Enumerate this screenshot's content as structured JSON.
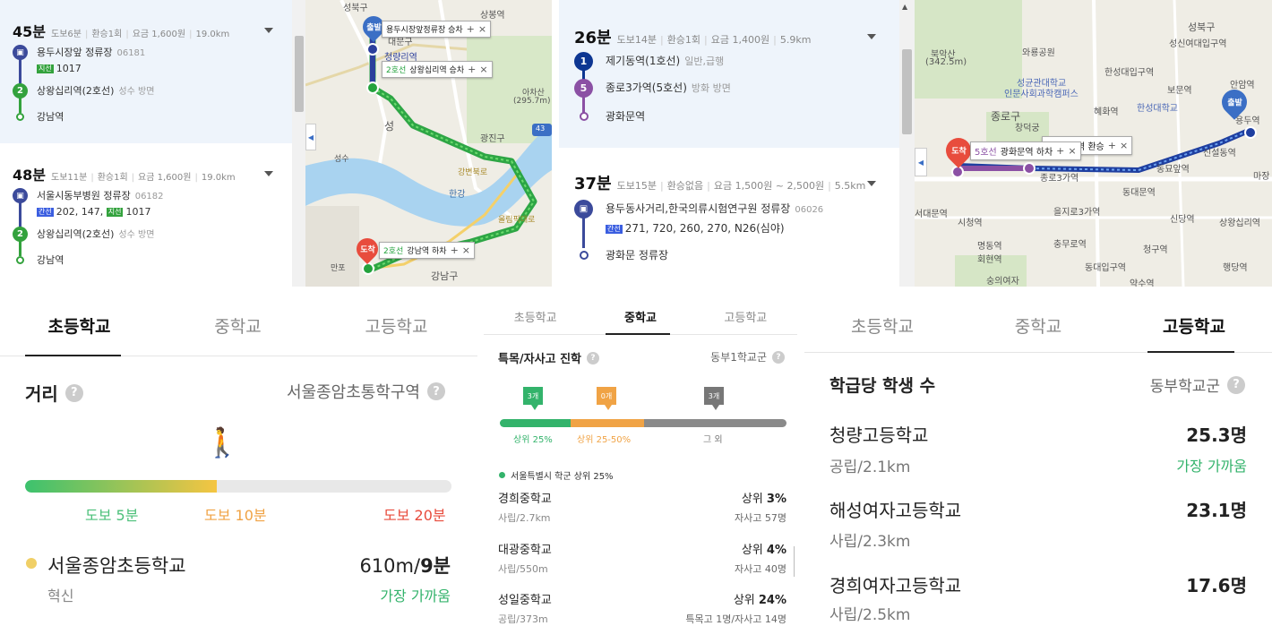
{
  "panel1": {
    "routes": [
      {
        "time": "45분",
        "meta": [
          "도보6분",
          "환승1회",
          "요금 1,600원",
          "19.0km"
        ],
        "steps": [
          {
            "name": "용두시장앞 정류장",
            "sub": "06181",
            "tag": "지선",
            "buses": "1017"
          },
          {
            "num": "2",
            "name": "상왕십리역(2호선)",
            "sub": "성수 방면"
          },
          {
            "name": "강남역"
          }
        ]
      },
      {
        "time": "48분",
        "meta": [
          "도보11분",
          "환승1회",
          "요금 1,600원",
          "19.0km"
        ],
        "steps": [
          {
            "name": "서울시동부병원 정류장",
            "sub": "06182",
            "tag": "간선",
            "buses": "202, 147,",
            "tag2": "지선",
            "buses2": "1017"
          },
          {
            "num": "2",
            "name": "상왕십리역(2호선)",
            "sub": "성수 방면"
          },
          {
            "name": "강남역"
          }
        ]
      }
    ],
    "map": {
      "start_pin": "출발",
      "end_pin": "도착",
      "popups": [
        {
          "line": "",
          "text": "용두시장앞정류장 승차"
        },
        {
          "line": "2호선",
          "text": "상왕십리역 승차"
        },
        {
          "line": "2호선",
          "text": "강남역 하차"
        }
      ],
      "labels": [
        "성북구",
        "상봉역",
        "대문구",
        "청량리역",
        "아차산",
        "(295.7m)",
        "광진구",
        "성",
        "한강",
        "성수",
        "강변북로",
        "올림픽대로",
        "만포",
        "강남구"
      ],
      "road_badge": "43"
    }
  },
  "panel2": {
    "routes": [
      {
        "time": "26분",
        "meta": [
          "도보14분",
          "환승1회",
          "요금 1,400원",
          "5.9km"
        ],
        "steps": [
          {
            "num": "1",
            "name": "제기동역(1호선)",
            "sub": "일반,급행"
          },
          {
            "num": "5",
            "name": "종로3가역(5호선)",
            "sub": "방화 방면"
          },
          {
            "name": "광화문역"
          }
        ]
      },
      {
        "time": "37분",
        "meta": [
          "도보15분",
          "환승없음",
          "요금 1,500원 ~ 2,500원",
          "5.5km"
        ],
        "steps": [
          {
            "name": "용두동사거리,한국의류시험연구원 정류장",
            "sub": "06026",
            "tag": "간선",
            "buses": "271, 720, 260, 270, N26(심야)"
          },
          {
            "name": "광화문 정류장"
          }
        ]
      }
    ],
    "map": {
      "start_pin": "출발",
      "end_pin": "도착",
      "popups": [
        {
          "line": "5호선",
          "text": "광화문역 하차"
        },
        {
          "line": "",
          "text": "종로3가역 환승"
        }
      ],
      "labels": [
        "성북구",
        "북악산",
        "(342.5m)",
        "와룡공원",
        "성신여대입구역",
        "한성대입구역",
        "성균관대학교",
        "인문사회과학캠퍼스",
        "혜화역",
        "보문역",
        "안암역",
        "한성대학교",
        "종로구",
        "창덕궁",
        "신설동역",
        "용두역",
        "종로3가역",
        "동묘앞역",
        "동대문역",
        "시청역",
        "을지로3가역",
        "신당역",
        "상왕십리역",
        "명동역",
        "충무로역",
        "청구역",
        "회현역",
        "동대입구역",
        "숭의여자",
        "약수역",
        "행당역",
        "마장",
        "서대문역"
      ]
    }
  },
  "panel3": {
    "tabs": [
      "초등학교",
      "중학교",
      "고등학교"
    ],
    "active_tab": 0,
    "title": "거리",
    "district": "서울종암초통학구역",
    "bar_fill_fraction": 0.45,
    "scale": [
      "도보 5분",
      "도보 10분",
      "도보 20분"
    ],
    "school": {
      "name": "서울종암초등학교",
      "dist": "610m/",
      "min": "9분",
      "type": "혁신",
      "badge": "가장 가까움"
    }
  },
  "panel4": {
    "tabs": [
      "초등학교",
      "중학교",
      "고등학교"
    ],
    "active_tab": 1,
    "title": "특목/자사고 진학",
    "district": "동부1학교군",
    "flags": [
      "3개",
      "0개",
      "3개"
    ],
    "segments": [
      "상위 25%",
      "상위 25-50%",
      "그 외"
    ],
    "legend": "서울특별시 학군 상위 25%",
    "schools": [
      {
        "name": "경희중학교",
        "sub": "사립/2.7km",
        "rank": "상위 ",
        "rank_val": "3%",
        "detail": "자사고 57명"
      },
      {
        "name": "대광중학교",
        "sub": "사립/550m",
        "rank": "상위 ",
        "rank_val": "4%",
        "detail": "자사고 40명"
      },
      {
        "name": "성일중학교",
        "sub": "공립/373m",
        "rank": "상위 ",
        "rank_val": "24%",
        "detail": "특목고 1명/자사고 14명"
      }
    ]
  },
  "panel5": {
    "tabs": [
      "초등학교",
      "중학교",
      "고등학교"
    ],
    "active_tab": 2,
    "title": "학급당 학생 수",
    "district": "동부학교군",
    "schools": [
      {
        "name": "청량고등학교",
        "sub": "공립/2.1km",
        "value": "25.3명",
        "badge": "가장 가까움"
      },
      {
        "name": "해성여자고등학교",
        "sub": "사립/2.3km",
        "value": "23.1명",
        "badge": ""
      },
      {
        "name": "경희여자고등학교",
        "sub": "사립/2.5km",
        "value": "17.6명",
        "badge": ""
      }
    ]
  },
  "colors": {
    "bus_blue": "#3b4a9b",
    "line2_green": "#33a23d",
    "line1_navy": "#0d3692",
    "line5_purple": "#8b50a4",
    "walk_green": "#33b36b",
    "orange": "#f0a345",
    "red": "#e84c3d",
    "route_bg": "#eef4fb"
  }
}
